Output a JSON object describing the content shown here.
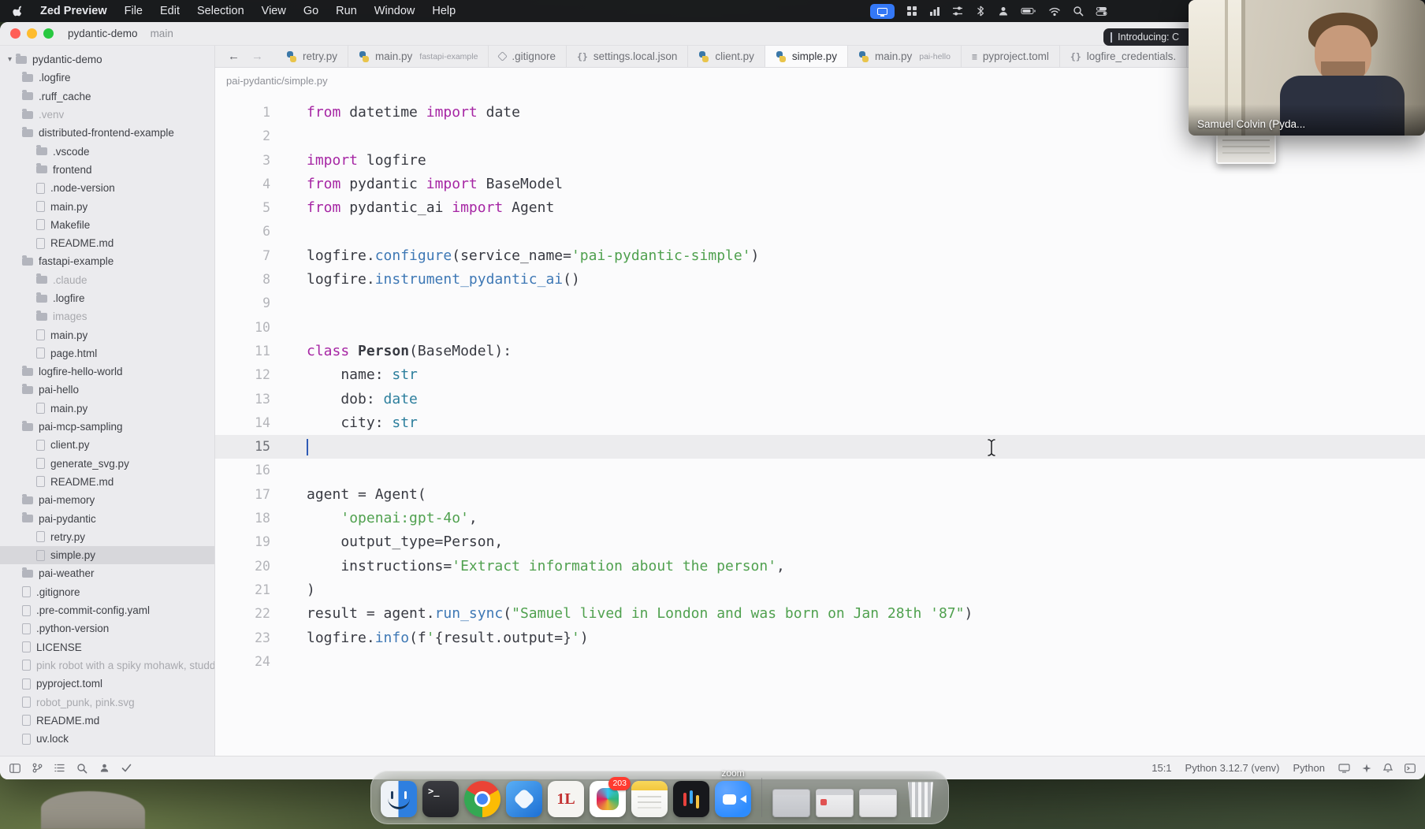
{
  "menu_bar": {
    "app_name": "Zed Preview",
    "menus": [
      "File",
      "Edit",
      "Selection",
      "View",
      "Go",
      "Run",
      "Window",
      "Help"
    ],
    "status_icons": [
      "screen-share",
      "grid",
      "chart",
      "sliders",
      "bluetooth",
      "user",
      "battery",
      "wifi",
      "search",
      "control-center"
    ],
    "notification": "Introducing: C"
  },
  "window": {
    "project": "pydantic-demo",
    "branch": "main"
  },
  "sidebar": {
    "items": [
      {
        "label": "pydantic-demo",
        "type": "folder",
        "depth": 0,
        "chevron": true
      },
      {
        "label": ".logfire",
        "type": "folder",
        "depth": 1
      },
      {
        "label": ".ruff_cache",
        "type": "folder",
        "depth": 1
      },
      {
        "label": ".venv",
        "type": "folder",
        "depth": 1,
        "dimmed": true
      },
      {
        "label": "distributed-frontend-example",
        "type": "folder",
        "depth": 1
      },
      {
        "label": ".vscode",
        "type": "folder",
        "depth": 2
      },
      {
        "label": "frontend",
        "type": "folder",
        "depth": 2
      },
      {
        "label": ".node-version",
        "type": "file",
        "depth": 2
      },
      {
        "label": "main.py",
        "type": "file",
        "depth": 2
      },
      {
        "label": "Makefile",
        "type": "file",
        "depth": 2
      },
      {
        "label": "README.md",
        "type": "file",
        "depth": 2
      },
      {
        "label": "fastapi-example",
        "type": "folder",
        "depth": 1
      },
      {
        "label": ".claude",
        "type": "folder",
        "depth": 2,
        "dimmed": true
      },
      {
        "label": ".logfire",
        "type": "folder",
        "depth": 2
      },
      {
        "label": "images",
        "type": "folder",
        "depth": 2,
        "dimmed": true
      },
      {
        "label": "main.py",
        "type": "file",
        "depth": 2
      },
      {
        "label": "page.html",
        "type": "file",
        "depth": 2
      },
      {
        "label": "logfire-hello-world",
        "type": "folder",
        "depth": 1
      },
      {
        "label": "pai-hello",
        "type": "folder",
        "depth": 1
      },
      {
        "label": "main.py",
        "type": "file",
        "depth": 2
      },
      {
        "label": "pai-mcp-sampling",
        "type": "folder",
        "depth": 1
      },
      {
        "label": "client.py",
        "type": "file",
        "depth": 2
      },
      {
        "label": "generate_svg.py",
        "type": "file",
        "depth": 2
      },
      {
        "label": "README.md",
        "type": "file",
        "depth": 2
      },
      {
        "label": "pai-memory",
        "type": "folder",
        "depth": 1
      },
      {
        "label": "pai-pydantic",
        "type": "folder",
        "depth": 1
      },
      {
        "label": "retry.py",
        "type": "file",
        "depth": 2
      },
      {
        "label": "simple.py",
        "type": "file",
        "depth": 2,
        "selected": true
      },
      {
        "label": "pai-weather",
        "type": "folder",
        "depth": 1
      },
      {
        "label": ".gitignore",
        "type": "file",
        "depth": 1
      },
      {
        "label": ".pre-commit-config.yaml",
        "type": "file",
        "depth": 1
      },
      {
        "label": ".python-version",
        "type": "file",
        "depth": 1
      },
      {
        "label": "LICENSE",
        "type": "file",
        "depth": 1
      },
      {
        "label": "pink robot with a spiky mohawk, studded l",
        "type": "file",
        "depth": 1,
        "dimmed": true
      },
      {
        "label": "pyproject.toml",
        "type": "file",
        "depth": 1
      },
      {
        "label": "robot_punk, pink.svg",
        "type": "file",
        "depth": 1,
        "dimmed": true
      },
      {
        "label": "README.md",
        "type": "file",
        "depth": 1
      },
      {
        "label": "uv.lock",
        "type": "file",
        "depth": 1
      }
    ]
  },
  "editor": {
    "nav": {
      "back": "←",
      "forward": "→"
    },
    "tabs": [
      {
        "label": "retry.py",
        "icon": "python"
      },
      {
        "label": "main.py",
        "detail": "fastapi-example",
        "icon": "python"
      },
      {
        "label": ".gitignore",
        "icon": "git"
      },
      {
        "label": "settings.local.json",
        "icon": "braces"
      },
      {
        "label": "client.py",
        "icon": "python"
      },
      {
        "label": "simple.py",
        "icon": "python",
        "active": true
      },
      {
        "label": "main.py",
        "detail": "pai-hello",
        "icon": "python"
      },
      {
        "label": "pyproject.toml",
        "icon": "toml"
      },
      {
        "label": "logfire_credentials.",
        "icon": "braces"
      }
    ],
    "breadcrumb": "pai-pydantic/simple.py",
    "cursor_line": 15,
    "lines": [
      {
        "n": 1,
        "segs": [
          [
            "k",
            "from"
          ],
          [
            "p",
            " datetime "
          ],
          [
            "k",
            "import"
          ],
          [
            "p",
            " date"
          ]
        ]
      },
      {
        "n": 2,
        "segs": []
      },
      {
        "n": 3,
        "segs": [
          [
            "k",
            "import"
          ],
          [
            "p",
            " logfire"
          ]
        ]
      },
      {
        "n": 4,
        "segs": [
          [
            "k",
            "from"
          ],
          [
            "p",
            " pydantic "
          ],
          [
            "k",
            "import"
          ],
          [
            "p",
            " BaseModel"
          ]
        ]
      },
      {
        "n": 5,
        "segs": [
          [
            "k",
            "from"
          ],
          [
            "p",
            " pydantic_ai "
          ],
          [
            "k",
            "import"
          ],
          [
            "p",
            " Agent"
          ]
        ]
      },
      {
        "n": 6,
        "segs": []
      },
      {
        "n": 7,
        "segs": [
          [
            "p",
            "logfire."
          ],
          [
            "f",
            "configure"
          ],
          [
            "p",
            "(service_name="
          ],
          [
            "s",
            "'pai-pydantic-simple'"
          ],
          [
            "p",
            ")"
          ]
        ]
      },
      {
        "n": 8,
        "segs": [
          [
            "p",
            "logfire."
          ],
          [
            "f",
            "instrument_pydantic_ai"
          ],
          [
            "p",
            "()"
          ]
        ]
      },
      {
        "n": 9,
        "segs": []
      },
      {
        "n": 10,
        "segs": []
      },
      {
        "n": 11,
        "segs": [
          [
            "k",
            "class"
          ],
          [
            "p",
            " "
          ],
          [
            "b",
            "Person"
          ],
          [
            "p",
            "(BaseModel):"
          ]
        ]
      },
      {
        "n": 12,
        "segs": [
          [
            "p",
            "    name: "
          ],
          [
            "t",
            "str"
          ]
        ]
      },
      {
        "n": 13,
        "segs": [
          [
            "p",
            "    dob: "
          ],
          [
            "t",
            "date"
          ]
        ]
      },
      {
        "n": 14,
        "segs": [
          [
            "p",
            "    city: "
          ],
          [
            "t",
            "str"
          ]
        ]
      },
      {
        "n": 15,
        "segs": []
      },
      {
        "n": 16,
        "segs": []
      },
      {
        "n": 17,
        "segs": [
          [
            "p",
            "agent = Agent("
          ]
        ]
      },
      {
        "n": 18,
        "segs": [
          [
            "p",
            "    "
          ],
          [
            "s",
            "'openai:gpt-4o'"
          ],
          [
            "p",
            ","
          ]
        ]
      },
      {
        "n": 19,
        "segs": [
          [
            "p",
            "    output_type=Person,"
          ]
        ]
      },
      {
        "n": 20,
        "segs": [
          [
            "p",
            "    instructions="
          ],
          [
            "s",
            "'Extract information about the person'"
          ],
          [
            "p",
            ","
          ]
        ]
      },
      {
        "n": 21,
        "segs": [
          [
            "p",
            ")"
          ]
        ]
      },
      {
        "n": 22,
        "segs": [
          [
            "p",
            "result = agent."
          ],
          [
            "f",
            "run_sync"
          ],
          [
            "p",
            "("
          ],
          [
            "s",
            "\"Samuel lived in London and was born on Jan 28th '87\""
          ],
          [
            "p",
            ")"
          ]
        ]
      },
      {
        "n": 23,
        "segs": [
          [
            "p",
            "logfire."
          ],
          [
            "f",
            "info"
          ],
          [
            "p",
            "(f"
          ],
          [
            "s",
            "'"
          ],
          [
            "p",
            "{result.output=}"
          ],
          [
            "s",
            "'"
          ],
          [
            "p",
            ")"
          ]
        ]
      },
      {
        "n": 24,
        "segs": []
      }
    ]
  },
  "status_bar": {
    "left_icons": [
      "project-panel",
      "git-branch",
      "outline",
      "search",
      "collab",
      "diagnostics-check"
    ],
    "cursor_position": "15:1",
    "interpreter": "Python 3.12.7 (venv)",
    "language": "Python",
    "right_icons": [
      "screen",
      "assistant",
      "bell",
      "terminal-panel"
    ]
  },
  "webcam": {
    "label": "Samuel Colvin (Pyda..."
  },
  "dock": {
    "apps": [
      {
        "id": "finder"
      },
      {
        "id": "terminal"
      },
      {
        "id": "chrome"
      },
      {
        "id": "blue-app"
      },
      {
        "id": "one-l",
        "glyph": "1L"
      },
      {
        "id": "colorful",
        "badge": "203"
      },
      {
        "id": "notes"
      },
      {
        "id": "media"
      },
      {
        "id": "zoom",
        "tooltip": "zoom"
      }
    ],
    "minimized_windows": 3,
    "trash": true
  },
  "colors": {
    "accent_blue": "#2d8cff",
    "keyword": "#a626a4",
    "string": "#50a14f",
    "function": "#3e78b5",
    "type": "#2d7f9d",
    "badge_red": "#ff3b30",
    "selection_gray": "#d7d7db"
  }
}
